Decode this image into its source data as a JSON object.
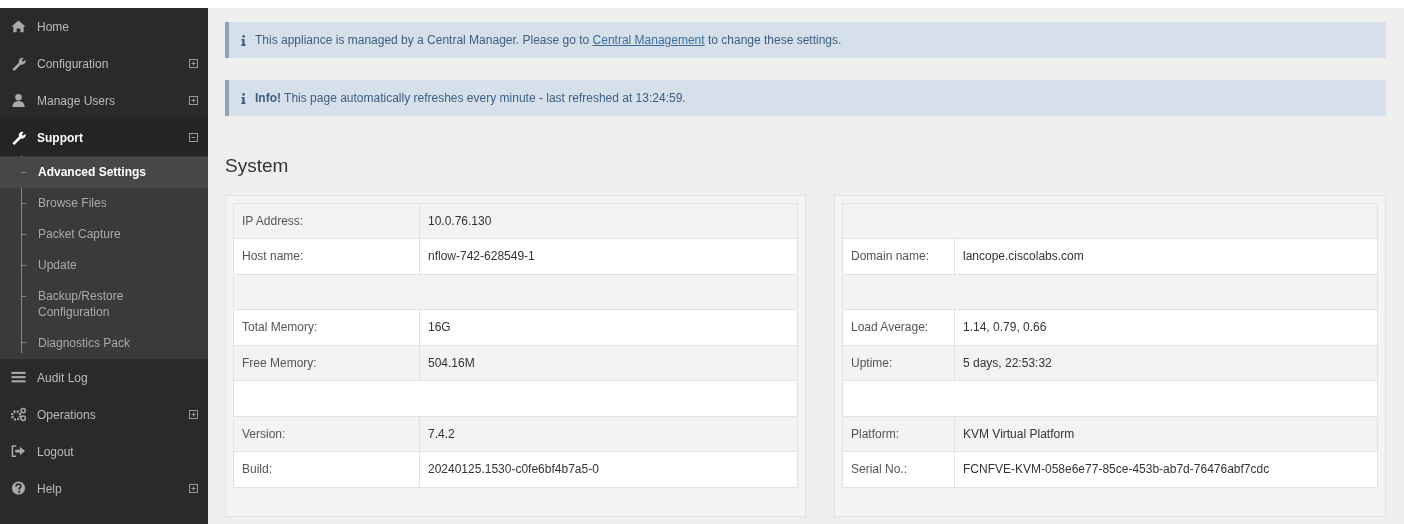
{
  "sidebar": {
    "items": [
      {
        "label": "Home"
      },
      {
        "label": "Configuration",
        "expanded": false
      },
      {
        "label": "Manage Users",
        "expanded": false
      },
      {
        "label": "Support",
        "expanded": true,
        "children": [
          {
            "label": "Advanced Settings",
            "selected": true
          },
          {
            "label": "Browse Files",
            "selected": false
          },
          {
            "label": "Packet Capture",
            "selected": false
          },
          {
            "label": "Update",
            "selected": false
          },
          {
            "label": "Backup/Restore Configuration",
            "selected": false
          },
          {
            "label": "Diagnostics Pack",
            "selected": false
          }
        ]
      },
      {
        "label": "Audit Log"
      },
      {
        "label": "Operations",
        "expanded": false
      },
      {
        "label": "Logout"
      },
      {
        "label": "Help",
        "expanded": false
      }
    ]
  },
  "alerts": [
    {
      "text_before": "This appliance is managed by a Central Manager. Please go to",
      "link": "Central Management",
      "text_after": "to change these settings."
    },
    {
      "text": "**Info!** This page automatically refreshes every minute - last refreshed at 13:24:59."
    }
  ],
  "section_title": "System",
  "tables": [
    {
      "rows": [
        {
          "kind": "field",
          "label": "IP Address:",
          "value": "10.0.76.130"
        },
        {
          "kind": "field",
          "label": "Host name:",
          "value": "nflow-742-628549-1"
        },
        {
          "kind": "spacer"
        },
        {
          "kind": "field",
          "label": "Total Memory:",
          "value": "16G"
        },
        {
          "kind": "field",
          "label": "Free Memory:",
          "value": "504.16M"
        },
        {
          "kind": "spacer"
        },
        {
          "kind": "field",
          "label": "Version:",
          "value": "7.4.2"
        },
        {
          "kind": "field",
          "label": "Build:",
          "value": "20240125.1530-c0fe6bf4b7a5-0"
        }
      ]
    },
    {
      "rows": [
        {
          "kind": "spacer"
        },
        {
          "kind": "field",
          "label": "Domain name:",
          "value": "lancope.ciscolabs.com"
        },
        {
          "kind": "spacer"
        },
        {
          "kind": "field",
          "label": "Load Average:",
          "value": "1.14, 0.79, 0.66"
        },
        {
          "kind": "field",
          "label": "Uptime:",
          "value": "5 days, 22:53:32"
        },
        {
          "kind": "spacer"
        },
        {
          "kind": "field",
          "label": "Platform:",
          "value": "KVM Virtual Platform"
        },
        {
          "kind": "field",
          "label": "Serial No.:",
          "value": "FCNFVE-KVM-058e6e77-85ce-453b-ab7d-76476abf7cdc"
        }
      ]
    }
  ]
}
